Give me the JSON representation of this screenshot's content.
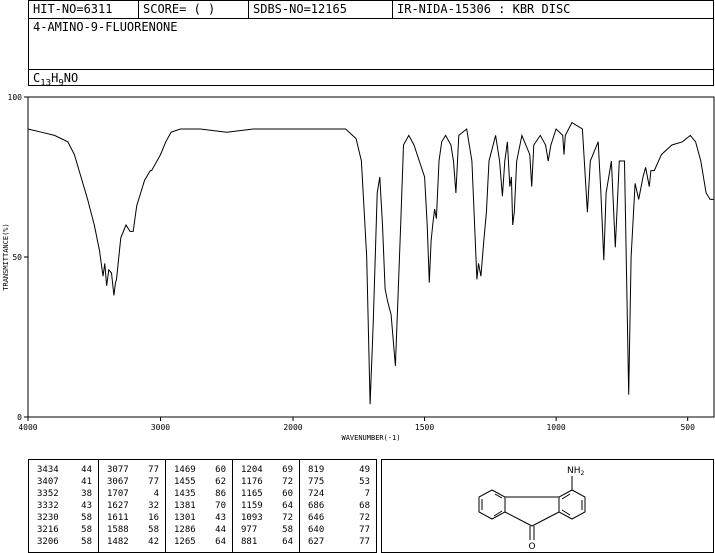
{
  "header": {
    "hit_no": "HIT-NO=6311",
    "score": "SCORE=  (   )",
    "sdbs_no": "SDBS-NO=12165",
    "source": "IR-NIDA-15306 : KBR DISC",
    "compound_name": "4-AMINO-9-FLUORENONE",
    "formula": {
      "c": "C",
      "c_n": "13",
      "h": "H",
      "h_n": "9",
      "rest": "NO"
    }
  },
  "chart_data": {
    "type": "line",
    "xlabel": "WAVENUMBER(-1)",
    "ylabel": "TRANSMITTANCE(%)",
    "xlim": [
      4000,
      400
    ],
    "ylim": [
      0,
      100
    ],
    "x_reversed": true,
    "x_ticks": [
      4000,
      3000,
      2000,
      1500,
      1000,
      500
    ],
    "x_tick_labels": [
      "4000",
      "3000",
      "2000",
      "1500",
      "1000",
      "500"
    ],
    "y_ticks": [
      0,
      50,
      100
    ],
    "y_tick_labels": [
      "0",
      "50",
      "100"
    ],
    "x_scale": "piecewise linear, break at 2000 (4000-2000 and 2000-400 each drawn at their own scale)",
    "spectrum": [
      [
        4000,
        90
      ],
      [
        3900,
        89
      ],
      [
        3800,
        88
      ],
      [
        3700,
        86
      ],
      [
        3650,
        82
      ],
      [
        3600,
        75
      ],
      [
        3550,
        68
      ],
      [
        3500,
        60
      ],
      [
        3460,
        52
      ],
      [
        3434,
        44
      ],
      [
        3420,
        48
      ],
      [
        3407,
        41
      ],
      [
        3390,
        46
      ],
      [
        3370,
        45
      ],
      [
        3352,
        38
      ],
      [
        3340,
        42
      ],
      [
        3332,
        43
      ],
      [
        3300,
        56
      ],
      [
        3260,
        60
      ],
      [
        3230,
        58
      ],
      [
        3216,
        58
      ],
      [
        3206,
        58
      ],
      [
        3180,
        66
      ],
      [
        3120,
        74
      ],
      [
        3077,
        77
      ],
      [
        3067,
        77
      ],
      [
        3000,
        82
      ],
      [
        2960,
        86
      ],
      [
        2920,
        89
      ],
      [
        2850,
        90
      ],
      [
        2700,
        90
      ],
      [
        2500,
        89
      ],
      [
        2300,
        90
      ],
      [
        2100,
        90
      ],
      [
        2000,
        90
      ],
      [
        1900,
        90
      ],
      [
        1800,
        90
      ],
      [
        1760,
        87
      ],
      [
        1740,
        80
      ],
      [
        1720,
        50
      ],
      [
        1707,
        4
      ],
      [
        1695,
        30
      ],
      [
        1680,
        70
      ],
      [
        1670,
        75
      ],
      [
        1660,
        60
      ],
      [
        1650,
        40
      ],
      [
        1640,
        36
      ],
      [
        1627,
        32
      ],
      [
        1615,
        20
      ],
      [
        1611,
        16
      ],
      [
        1600,
        40
      ],
      [
        1590,
        62
      ],
      [
        1580,
        85
      ],
      [
        1560,
        88
      ],
      [
        1540,
        85
      ],
      [
        1520,
        80
      ],
      [
        1500,
        75
      ],
      [
        1490,
        60
      ],
      [
        1482,
        42
      ],
      [
        1475,
        55
      ],
      [
        1469,
        60
      ],
      [
        1462,
        65
      ],
      [
        1455,
        62
      ],
      [
        1445,
        80
      ],
      [
        1435,
        86
      ],
      [
        1420,
        88
      ],
      [
        1400,
        85
      ],
      [
        1390,
        80
      ],
      [
        1381,
        70
      ],
      [
        1370,
        88
      ],
      [
        1340,
        90
      ],
      [
        1320,
        80
      ],
      [
        1310,
        60
      ],
      [
        1301,
        43
      ],
      [
        1295,
        48
      ],
      [
        1286,
        44
      ],
      [
        1275,
        55
      ],
      [
        1265,
        64
      ],
      [
        1255,
        80
      ],
      [
        1230,
        88
      ],
      [
        1215,
        80
      ],
      [
        1204,
        69
      ],
      [
        1195,
        80
      ],
      [
        1185,
        86
      ],
      [
        1176,
        72
      ],
      [
        1170,
        75
      ],
      [
        1165,
        60
      ],
      [
        1159,
        64
      ],
      [
        1150,
        80
      ],
      [
        1130,
        88
      ],
      [
        1100,
        82
      ],
      [
        1093,
        72
      ],
      [
        1085,
        85
      ],
      [
        1060,
        88
      ],
      [
        1040,
        85
      ],
      [
        1030,
        80
      ],
      [
        1020,
        85
      ],
      [
        1000,
        90
      ],
      [
        975,
        88
      ],
      [
        970,
        82
      ],
      [
        965,
        88
      ],
      [
        940,
        92
      ],
      [
        900,
        90
      ],
      [
        881,
        64
      ],
      [
        870,
        80
      ],
      [
        840,
        86
      ],
      [
        830,
        70
      ],
      [
        819,
        49
      ],
      [
        810,
        70
      ],
      [
        790,
        80
      ],
      [
        775,
        53
      ],
      [
        760,
        80
      ],
      [
        740,
        80
      ],
      [
        724,
        7
      ],
      [
        715,
        50
      ],
      [
        700,
        73
      ],
      [
        686,
        68
      ],
      [
        670,
        75
      ],
      [
        660,
        78
      ],
      [
        646,
        72
      ],
      [
        640,
        77
      ],
      [
        627,
        77
      ],
      [
        600,
        82
      ],
      [
        560,
        85
      ],
      [
        520,
        86
      ],
      [
        490,
        88
      ],
      [
        470,
        86
      ],
      [
        450,
        80
      ],
      [
        430,
        70
      ],
      [
        415,
        68
      ],
      [
        400,
        68
      ]
    ],
    "peak_table": {
      "columns": [
        [
          [
            3434,
            44
          ],
          [
            3407,
            41
          ],
          [
            3352,
            38
          ],
          [
            3332,
            43
          ],
          [
            3230,
            58
          ],
          [
            3216,
            58
          ],
          [
            3206,
            58
          ]
        ],
        [
          [
            3077,
            77
          ],
          [
            3067,
            77
          ],
          [
            1707,
            4
          ],
          [
            1627,
            32
          ],
          [
            1611,
            16
          ],
          [
            1588,
            58
          ],
          [
            1482,
            42
          ]
        ],
        [
          [
            1469,
            60
          ],
          [
            1455,
            62
          ],
          [
            1435,
            86
          ],
          [
            1381,
            70
          ],
          [
            1301,
            43
          ],
          [
            1286,
            44
          ],
          [
            1265,
            64
          ]
        ],
        [
          [
            1204,
            69
          ],
          [
            1176,
            72
          ],
          [
            1165,
            60
          ],
          [
            1159,
            64
          ],
          [
            1093,
            72
          ],
          [
            977,
            58
          ],
          [
            881,
            64
          ]
        ],
        [
          [
            819,
            49
          ],
          [
            775,
            53
          ],
          [
            724,
            7
          ],
          [
            686,
            68
          ],
          [
            646,
            72
          ],
          [
            640,
            77
          ],
          [
            627,
            77
          ]
        ]
      ]
    }
  },
  "structure": {
    "amine_label": "NH",
    "amine_sub": "2",
    "ketone_label": "O"
  }
}
